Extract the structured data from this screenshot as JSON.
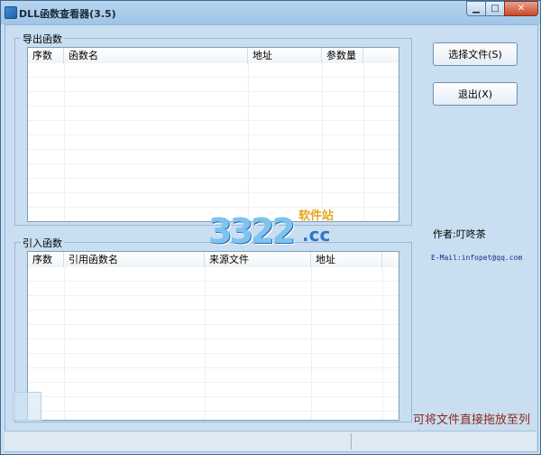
{
  "window": {
    "title": "DLL函数查看器(3.5)",
    "controls": {
      "minimize": "▁",
      "maximize": "□",
      "close": "✕"
    }
  },
  "exports_group": {
    "title": "导出函数",
    "columns": [
      "序数",
      "函数名",
      "地址",
      "参数量"
    ]
  },
  "imports_group": {
    "title": "引入函数",
    "columns": [
      "序数",
      "引用函数名",
      "来源文件",
      "地址"
    ]
  },
  "buttons": {
    "select_file": "选择文件(S)",
    "exit": "退出(X)"
  },
  "info": {
    "author": "作者:叮咚茶",
    "email": "E-Mail:infopet@qq.com",
    "drop_hint": "可将文件直接拖放至列表"
  },
  "watermark": {
    "number": "3322",
    "cc": ".cc",
    "site": "软件站"
  },
  "colors": {
    "titlebar": "#9fc4e6",
    "client_bg": "#c9def1",
    "drop_hint": "#8a2a1a",
    "email": "#1c2a8a"
  }
}
